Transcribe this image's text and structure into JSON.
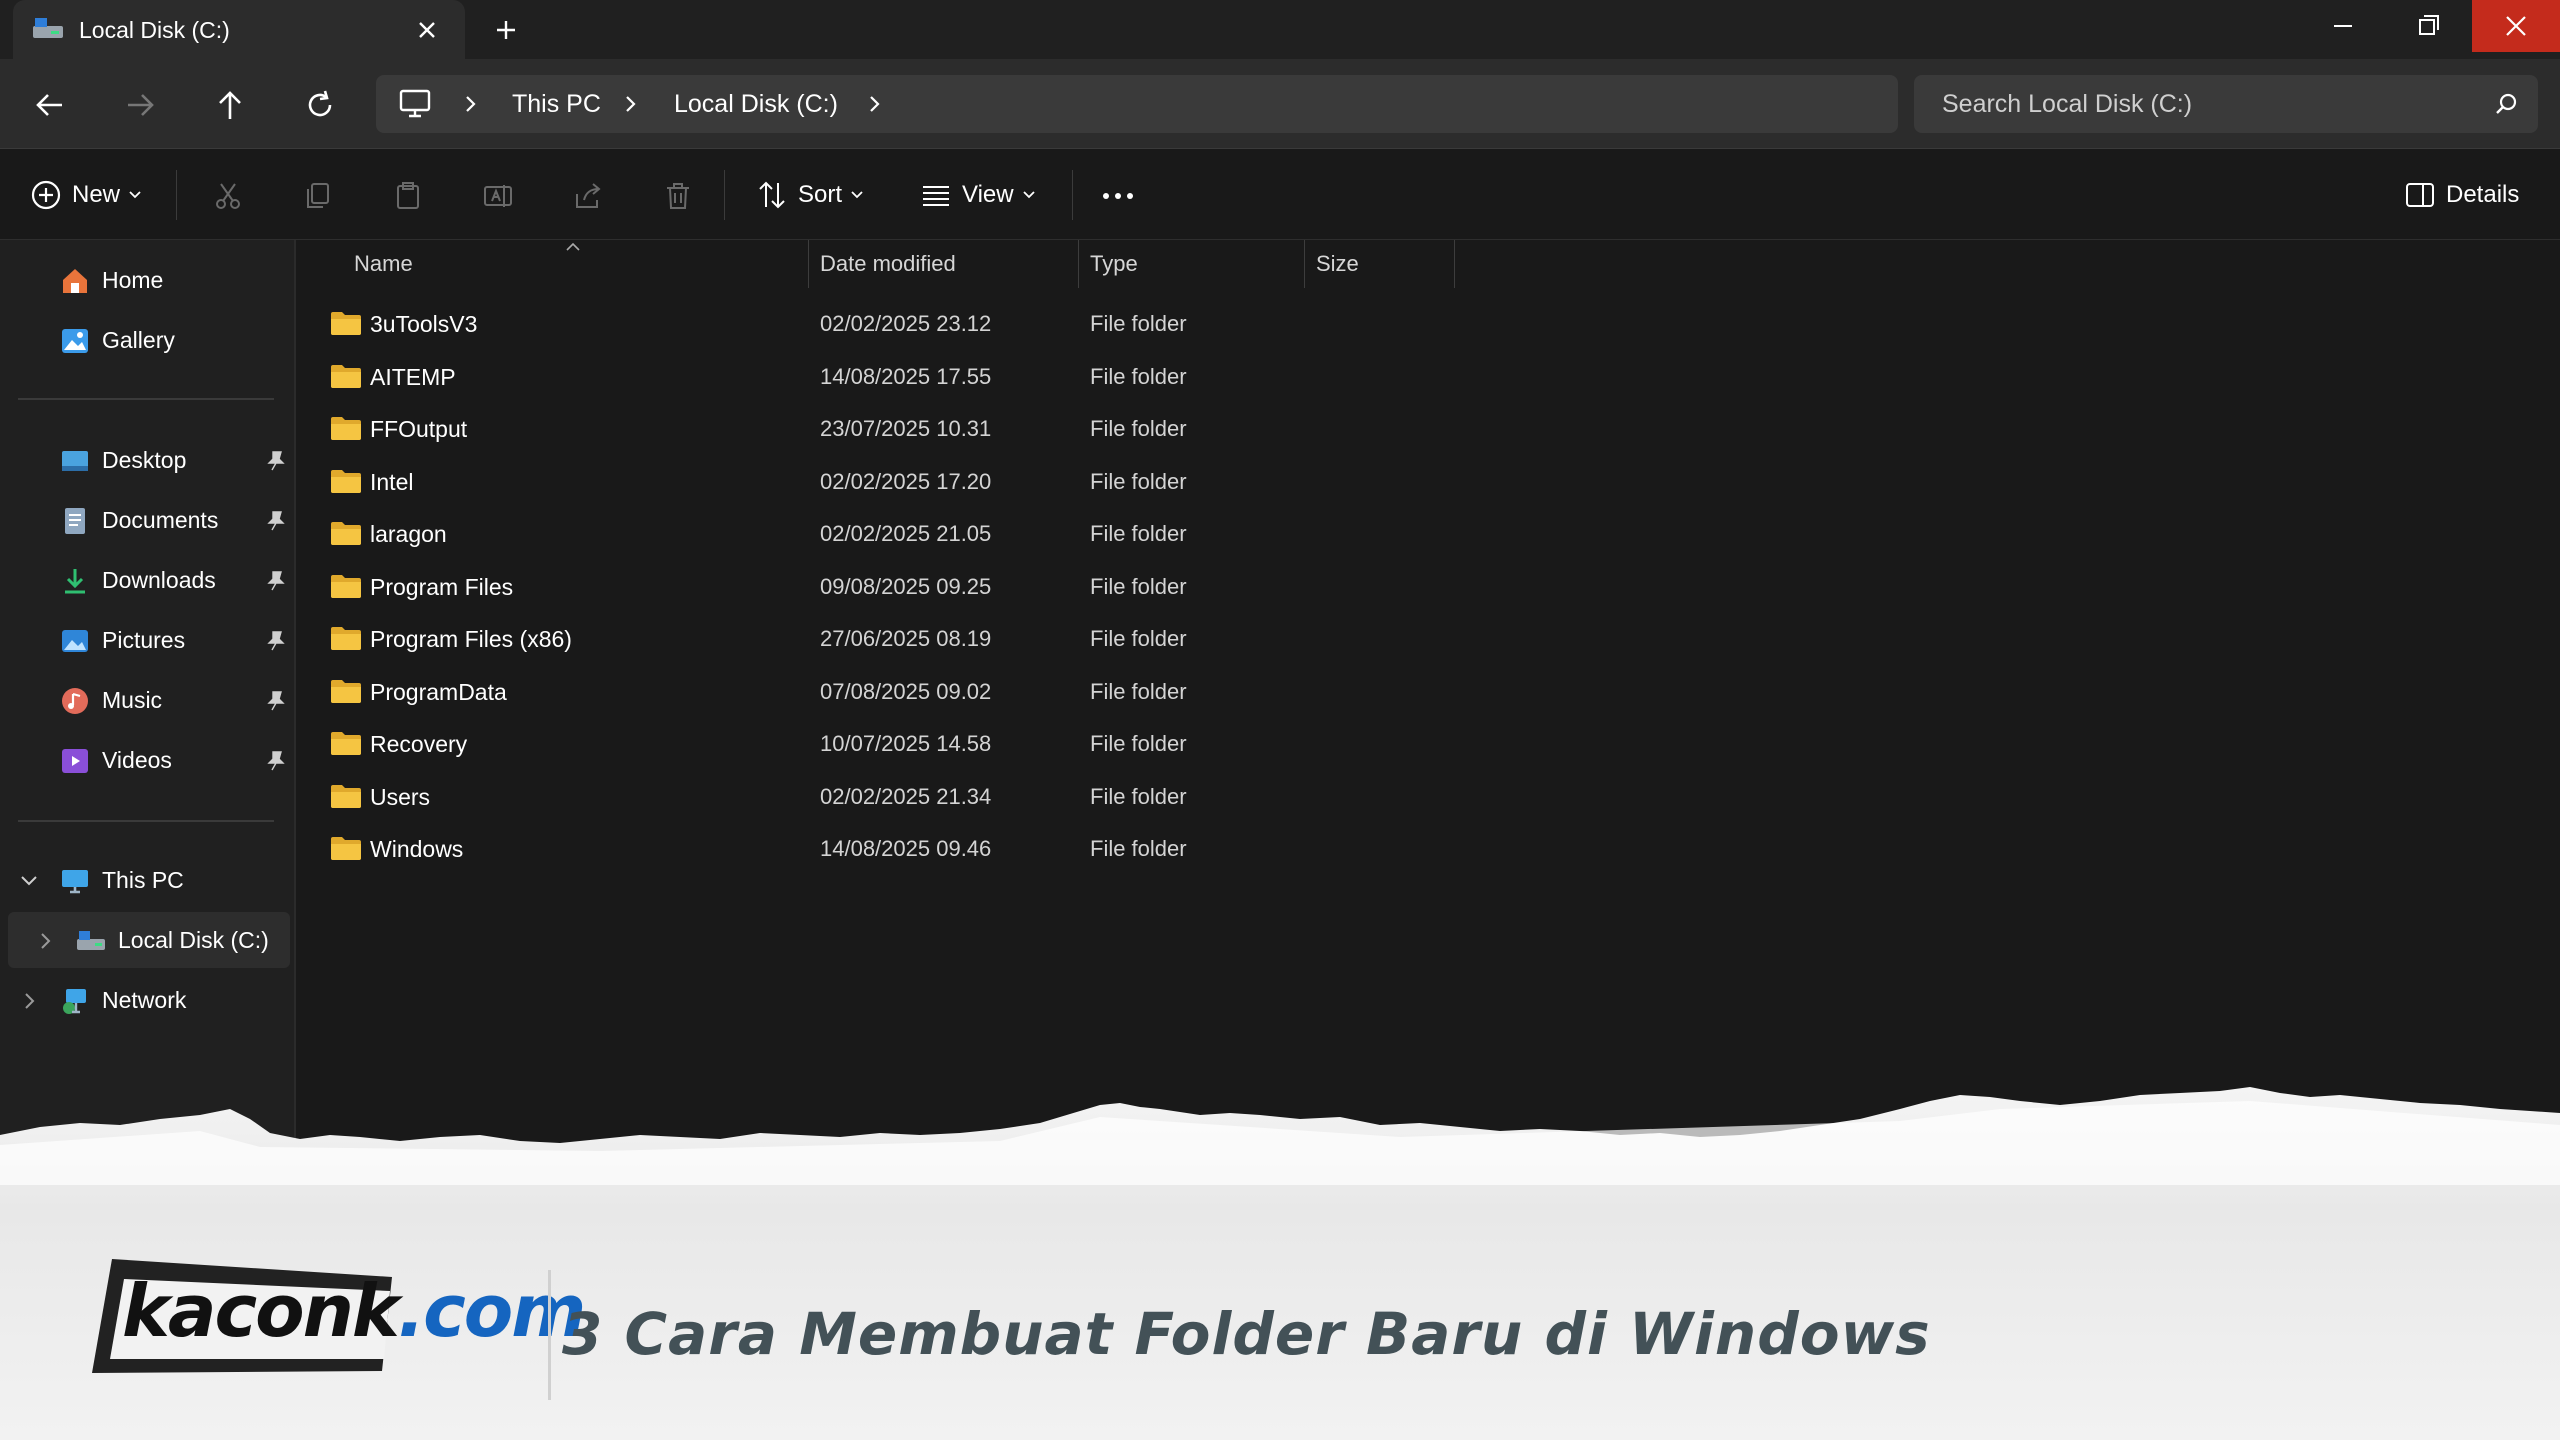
{
  "tab": {
    "title": "Local Disk (C:)"
  },
  "address": {
    "breadcrumbs": [
      "This PC",
      "Local Disk (C:)"
    ]
  },
  "search": {
    "placeholder": "Search Local Disk (C:)"
  },
  "commands": {
    "new_label": "New",
    "sort_label": "Sort",
    "view_label": "View",
    "details_label": "Details"
  },
  "sidebar": {
    "quick": [
      {
        "label": "Home",
        "icon": "home-icon"
      },
      {
        "label": "Gallery",
        "icon": "gallery-icon"
      }
    ],
    "pinned": [
      {
        "label": "Desktop",
        "icon": "desktop-icon"
      },
      {
        "label": "Documents",
        "icon": "documents-icon"
      },
      {
        "label": "Downloads",
        "icon": "downloads-icon"
      },
      {
        "label": "Pictures",
        "icon": "pictures-icon"
      },
      {
        "label": "Music",
        "icon": "music-icon"
      },
      {
        "label": "Videos",
        "icon": "videos-icon"
      }
    ],
    "tree": [
      {
        "label": "This PC",
        "icon": "this-pc-icon"
      },
      {
        "label": "Local Disk (C:)",
        "icon": "drive-icon"
      },
      {
        "label": "Network",
        "icon": "network-icon"
      }
    ]
  },
  "columns": [
    "Name",
    "Date modified",
    "Type",
    "Size"
  ],
  "files": [
    {
      "name": "3uToolsV3",
      "date": "02/02/2025 23.12",
      "type": "File folder"
    },
    {
      "name": "AITEMP",
      "date": "14/08/2025 17.55",
      "type": "File folder"
    },
    {
      "name": "FFOutput",
      "date": "23/07/2025 10.31",
      "type": "File folder"
    },
    {
      "name": "Intel",
      "date": "02/02/2025 17.20",
      "type": "File folder"
    },
    {
      "name": "laragon",
      "date": "02/02/2025 21.05",
      "type": "File folder"
    },
    {
      "name": "Program Files",
      "date": "09/08/2025 09.25",
      "type": "File folder"
    },
    {
      "name": "Program Files (x86)",
      "date": "27/06/2025 08.19",
      "type": "File folder"
    },
    {
      "name": "ProgramData",
      "date": "07/08/2025 09.02",
      "type": "File folder"
    },
    {
      "name": "Recovery",
      "date": "10/07/2025 14.58",
      "type": "File folder"
    },
    {
      "name": "Users",
      "date": "02/02/2025 21.34",
      "type": "File folder"
    },
    {
      "name": "Windows",
      "date": "14/08/2025 09.46",
      "type": "File folder"
    }
  ],
  "banner": {
    "logo_main": "kaconk",
    "logo_suffix": ".com",
    "headline": "3 Cara Membuat Folder Baru di Windows"
  },
  "colors": {
    "background": "#191919",
    "sidebar": "#202020",
    "folder": "#f5c542",
    "close_button": "#c42b1c",
    "headline": "#435157"
  }
}
